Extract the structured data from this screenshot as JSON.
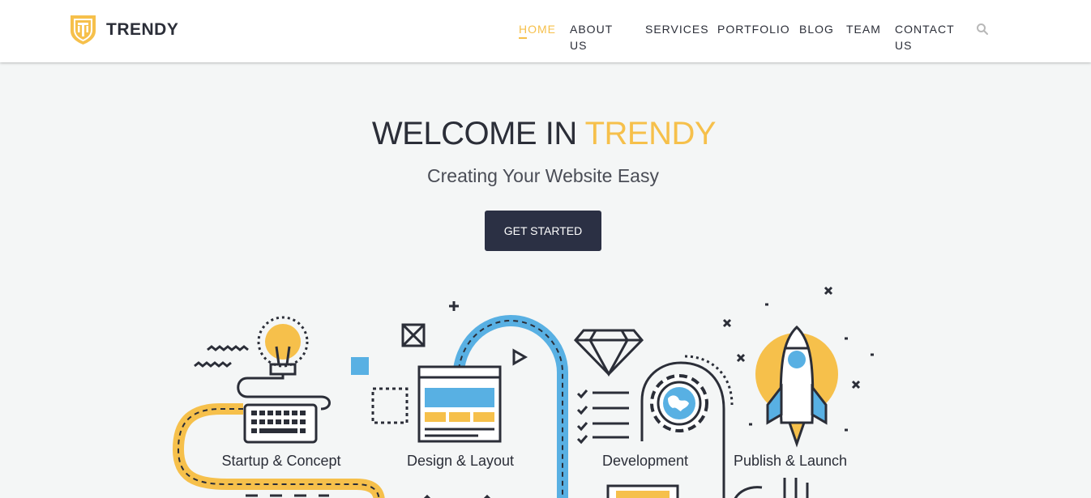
{
  "brand": {
    "name": "TRENDY",
    "logo_icon": "shield-logo-icon"
  },
  "nav": {
    "items": [
      {
        "label": "HOME",
        "active": true
      },
      {
        "label": "ABOUT US",
        "active": false
      },
      {
        "label": "SERVICES",
        "active": false
      },
      {
        "label": "PORTFOLIO",
        "active": false
      },
      {
        "label": "BLOG",
        "active": false
      },
      {
        "label": "TEAM",
        "active": false
      },
      {
        "label": "CONTACT US",
        "active": false
      }
    ],
    "search_icon": "search-icon"
  },
  "hero": {
    "title_main": "WELCOME IN",
    "title_accent": "TRENDY",
    "subtitle": "Creating Your Website Easy",
    "cta_label": "GET STARTED"
  },
  "steps": [
    {
      "label": "Startup & Concept",
      "icon": "lightbulb-keyboard-icon"
    },
    {
      "label": "Design & Layout",
      "icon": "browser-layout-icon"
    },
    {
      "label": "Development",
      "icon": "gear-globe-icon"
    },
    {
      "label": "Publish & Launch",
      "icon": "rocket-icon"
    }
  ],
  "colors": {
    "accent": "#f6c04b",
    "dark": "#2b2e38",
    "button": "#2b3044",
    "blue": "#58b0e3",
    "background": "#f4f6f6"
  }
}
